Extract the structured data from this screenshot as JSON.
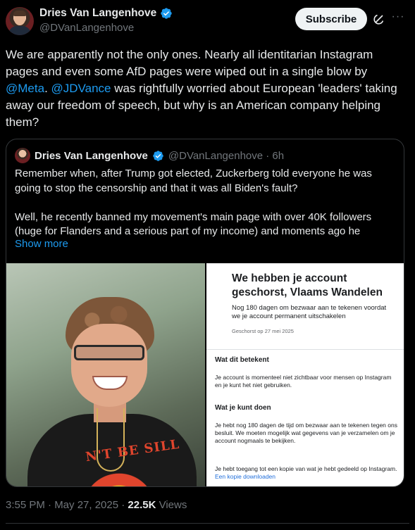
{
  "post": {
    "author_name": "Dries Van Langenhove",
    "author_handle": "@DVanLangenhove",
    "subscribe_label": "Subscribe",
    "text_before_meta": "We are apparently not the only ones. Nearly all identitarian Instagram pages and even some AfD pages were wiped out in a single blow by ",
    "mention_meta": "@Meta",
    "text_between": ". ",
    "mention_jdvance": "@JDVance",
    "text_after": " was rightfully worried about European 'leaders' taking away our freedom of speech, but why is an American company helping them?",
    "timestamp": "3:55 PM · May 27, 2025 · ",
    "views_count": "22.5K",
    "views_label": " Views"
  },
  "quote": {
    "author_name": "Dries Van Langenhove",
    "author_handle": "@DVanLangenhove · 6h",
    "text": "Remember when, after Trump got elected, Zuckerberg told everyone he was going to stop the censorship and that it was all Biden's fault?\n\nWell, he recently banned my movement's main page with over 40K followers (huge for Flanders and a serious part of my income) and moments ago he",
    "show_more": "Show more",
    "photo_shirt_text": "N'T BE SILL",
    "screenshot": {
      "title": "We hebben je account geschorst, Vlaams Wandelen",
      "subtitle": "Nog 180 dagen om bezwaar aan te tekenen voordat we je account permanent uitschakelen",
      "date": "Geschorst op 27 mei 2025",
      "section1_title": "Wat dit betekent",
      "section1_text": "Je account is momenteel niet zichtbaar voor mensen op Instagram en je kunt het niet gebruiken.",
      "section2_title": "Wat je kunt doen",
      "section2_text": "Je hebt nog 180 dagen de tijd om bezwaar aan te tekenen tegen ons besluit. We moeten mogelijk wat gegevens van je verzamelen om je account nogmaals te bekijken.",
      "section3_text": "Je hebt toegang tot een kopie van wat je hebt gedeeld op Instagram. ",
      "section3_link": "Een kopie downloaden"
    }
  },
  "colors": {
    "accent": "#1d9bf0",
    "background": "#000000",
    "muted": "#71767b"
  },
  "icons": [
    "verified-badge-icon",
    "grok-icon",
    "more-icon"
  ]
}
